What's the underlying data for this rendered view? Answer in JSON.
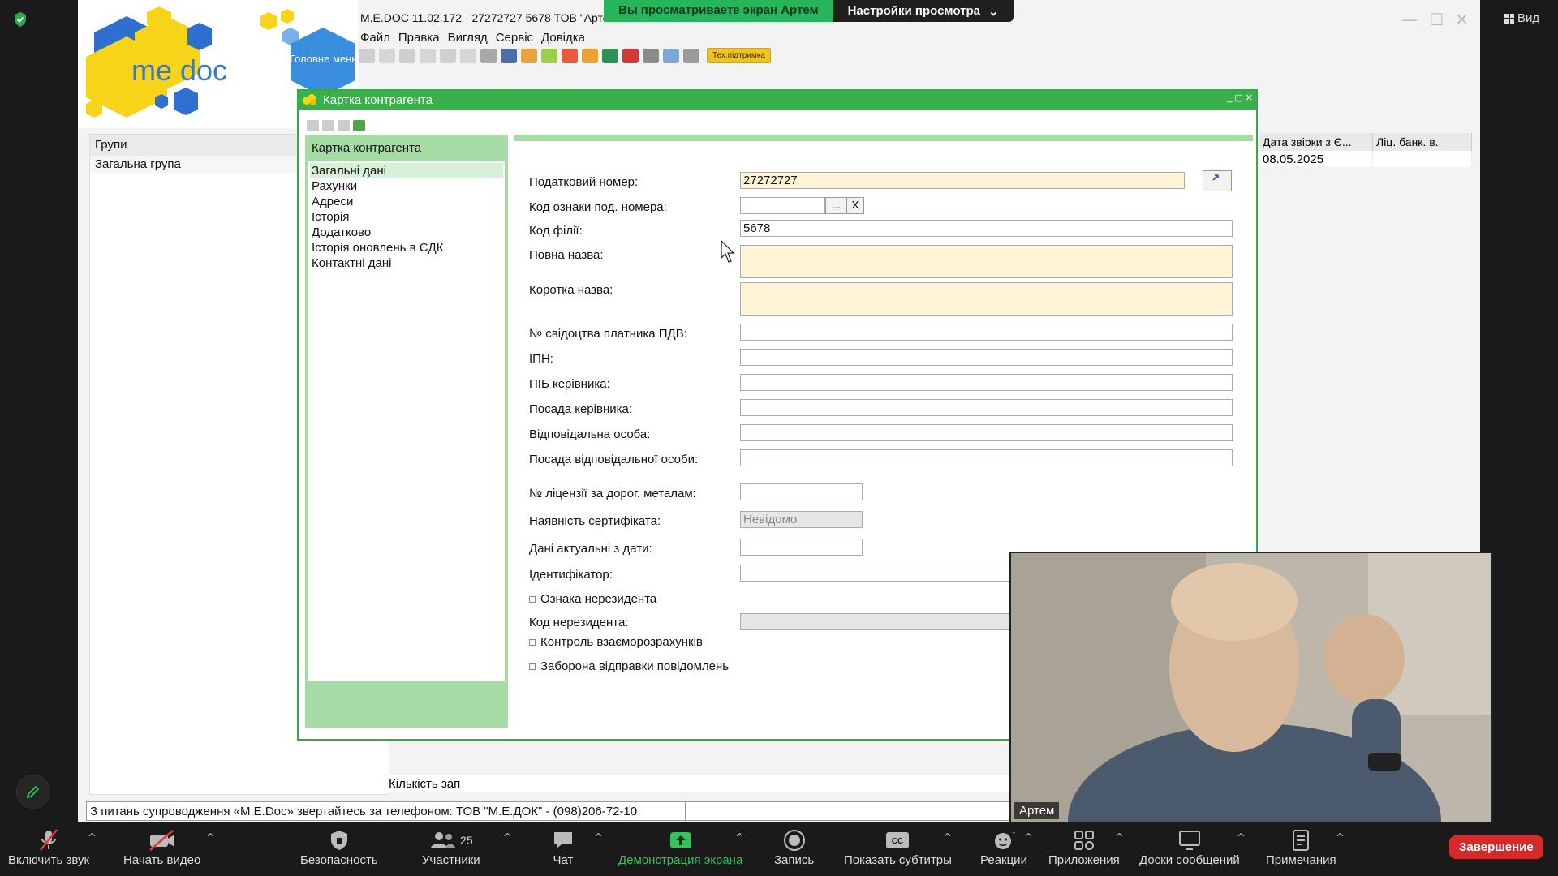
{
  "zoom": {
    "share_banner": {
      "viewing_text": "Вы просматриваете экран Артем",
      "options_label": "Настройки просмотра"
    },
    "view_label": "Вид",
    "participant_name": "Артем",
    "participants_count": "25",
    "toolbar": {
      "audio": "Включить звук",
      "video": "Начать видео",
      "security": "Безопасность",
      "participants": "Участники",
      "chat": "Чат",
      "share": "Демонстрация экрана",
      "record": "Запись",
      "captions": "Показать субтитры",
      "reactions": "Реакции",
      "apps": "Приложения",
      "whiteboards": "Доски сообщений",
      "notes": "Примечания",
      "end": "Завершение"
    },
    "colors": {
      "share_green": "#35c25a",
      "end_red": "#d42a2a"
    }
  },
  "medoc": {
    "brand": "me doc",
    "main_menu": "Головне меню",
    "title": "M.E.DOC 11.02.172  - 27272727 5678 ТОВ \"Арто",
    "menu": [
      "Файл",
      "Правка",
      "Вигляд",
      "Сервіс",
      "Довідка"
    ],
    "support_label": "Тех.підтримка",
    "groups": {
      "header": "Групи",
      "rows": [
        "Загальна група"
      ]
    },
    "right_grid": {
      "headers": [
        "Дата звірки з Є...",
        "Ліц. банк. в."
      ],
      "rows": [
        [
          "08.05.2025",
          ""
        ]
      ]
    },
    "bottom_grid_label": "Кількість зап",
    "status_text": "З питань супроводження «M.E.Doc» звертайтесь за телефоном: ТОВ \"М.Е.ДОК\" - (098)206-72-10"
  },
  "card": {
    "window_title": "Картка контрагента",
    "nav_header": "Картка контрагента",
    "nav_items": [
      "Загальні дані",
      "Рахунки",
      "Адреси",
      "Історія",
      "Додатково",
      "Історія оновлень в ЄДК",
      "Контактні дані"
    ],
    "fields": {
      "tax_number": {
        "label": "Податковий номер:",
        "value": "27272727"
      },
      "code_sign": {
        "label": "Код ознаки под. номера:",
        "value": "",
        "btn_dots": "...",
        "btn_clear": "X"
      },
      "branch_code": {
        "label": "Код філії:",
        "value": "5678"
      },
      "full_name": {
        "label": "Повна назва:",
        "value": ""
      },
      "short_name": {
        "label": "Коротка назва:",
        "value": ""
      },
      "vat_cert": {
        "label": "№ свідоцтва платника ПДВ:",
        "value": ""
      },
      "ipn": {
        "label": "ІПН:",
        "value": ""
      },
      "director": {
        "label": "ПІБ керівника:",
        "value": ""
      },
      "director_position": {
        "label": "Посада керівника:",
        "value": ""
      },
      "responsible": {
        "label": "Відповідальна особа:",
        "value": ""
      },
      "responsible_position": {
        "label": "Посада відповідальної особи:",
        "value": ""
      },
      "metals_license": {
        "label": "№ ліцензії за дорог. металам:",
        "value": ""
      },
      "certificate": {
        "label": "Наявність сертифіката:",
        "value": "Невідомо"
      },
      "actual_date": {
        "label": "Дані актуальні з дати:",
        "value": ""
      },
      "identifier": {
        "label": "Ідентифікатор:",
        "value": ""
      },
      "nonresident_sign": {
        "label": "Ознака нерезидента"
      },
      "nonresident_code": {
        "label": "Код нерезидента:",
        "value": ""
      },
      "settlement_control": {
        "label": "Контроль взаєморозрахунків"
      },
      "message_ban": {
        "label": "Заборона відправки повідомлень"
      }
    }
  }
}
